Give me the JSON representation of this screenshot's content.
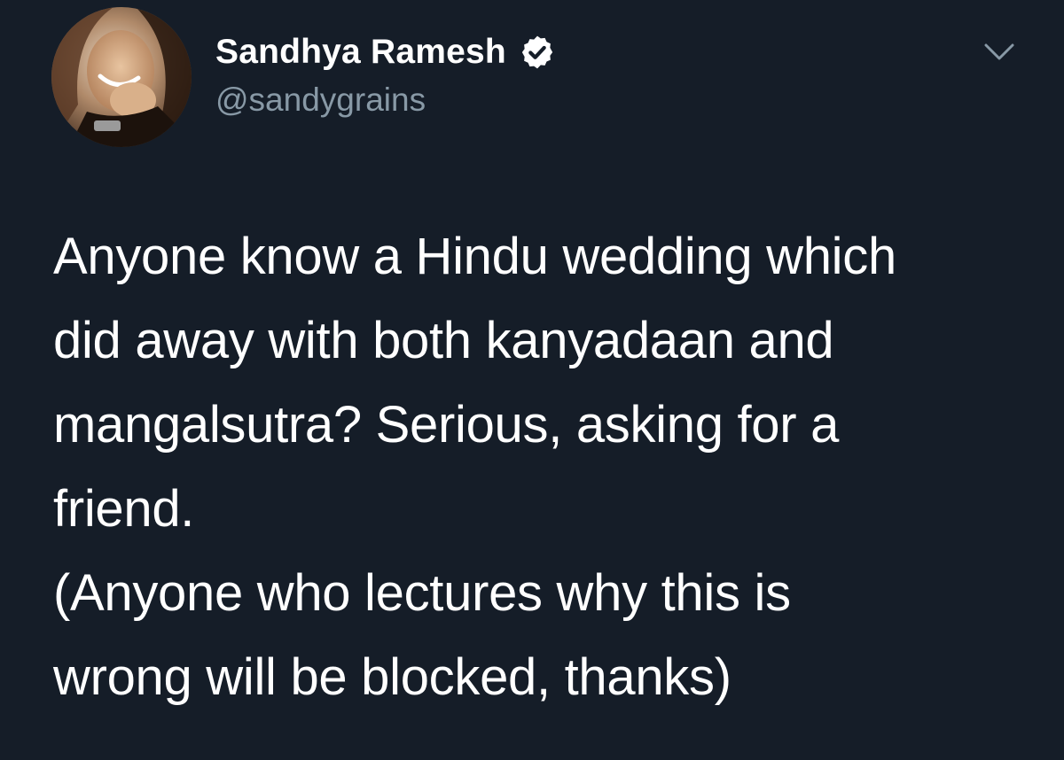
{
  "tweet": {
    "author": {
      "display_name": "Sandhya Ramesh",
      "handle": "@sandygrains",
      "verified": true
    },
    "text_lines": [
      "Anyone know a Hindu wedding which",
      "did away with both kanyadaan and",
      "mangalsutra? Serious, asking for a",
      "friend.",
      "(Anyone who lectures why this is",
      "wrong will be blocked, thanks)"
    ]
  },
  "colors": {
    "background": "#151d28",
    "text": "#ffffff",
    "secondary_text": "#8899a6",
    "verified_badge": "#ffffff"
  },
  "icons": {
    "verified": "verified-badge-icon",
    "more": "chevron-down-icon"
  }
}
